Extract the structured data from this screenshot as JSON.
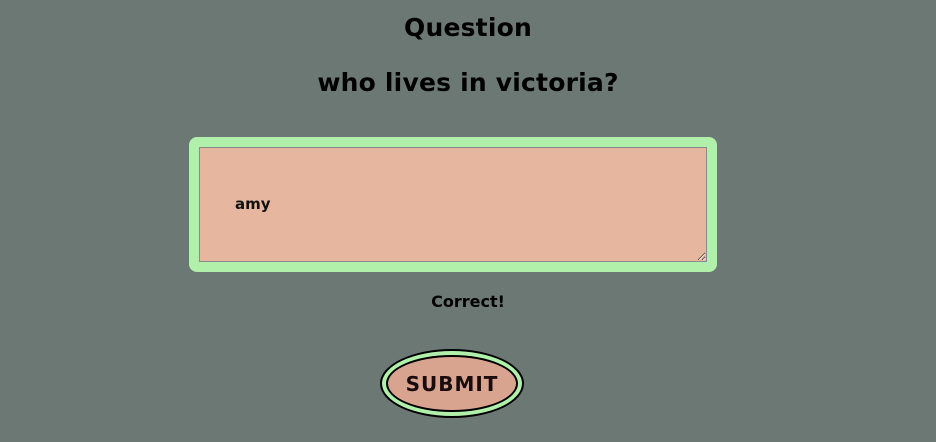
{
  "quiz": {
    "heading": "Question",
    "question": "who lives in victoria?",
    "answer_value": "amy",
    "answer_placeholder": "",
    "feedback": "Correct!",
    "submit_label": "SUBMIT"
  },
  "colors": {
    "background": "#6c7873",
    "field_frame": "#b0f0aa",
    "field_fill": "#e6b79e",
    "button_fill": "#d9a48f",
    "button_ring": "#b0f0aa"
  }
}
